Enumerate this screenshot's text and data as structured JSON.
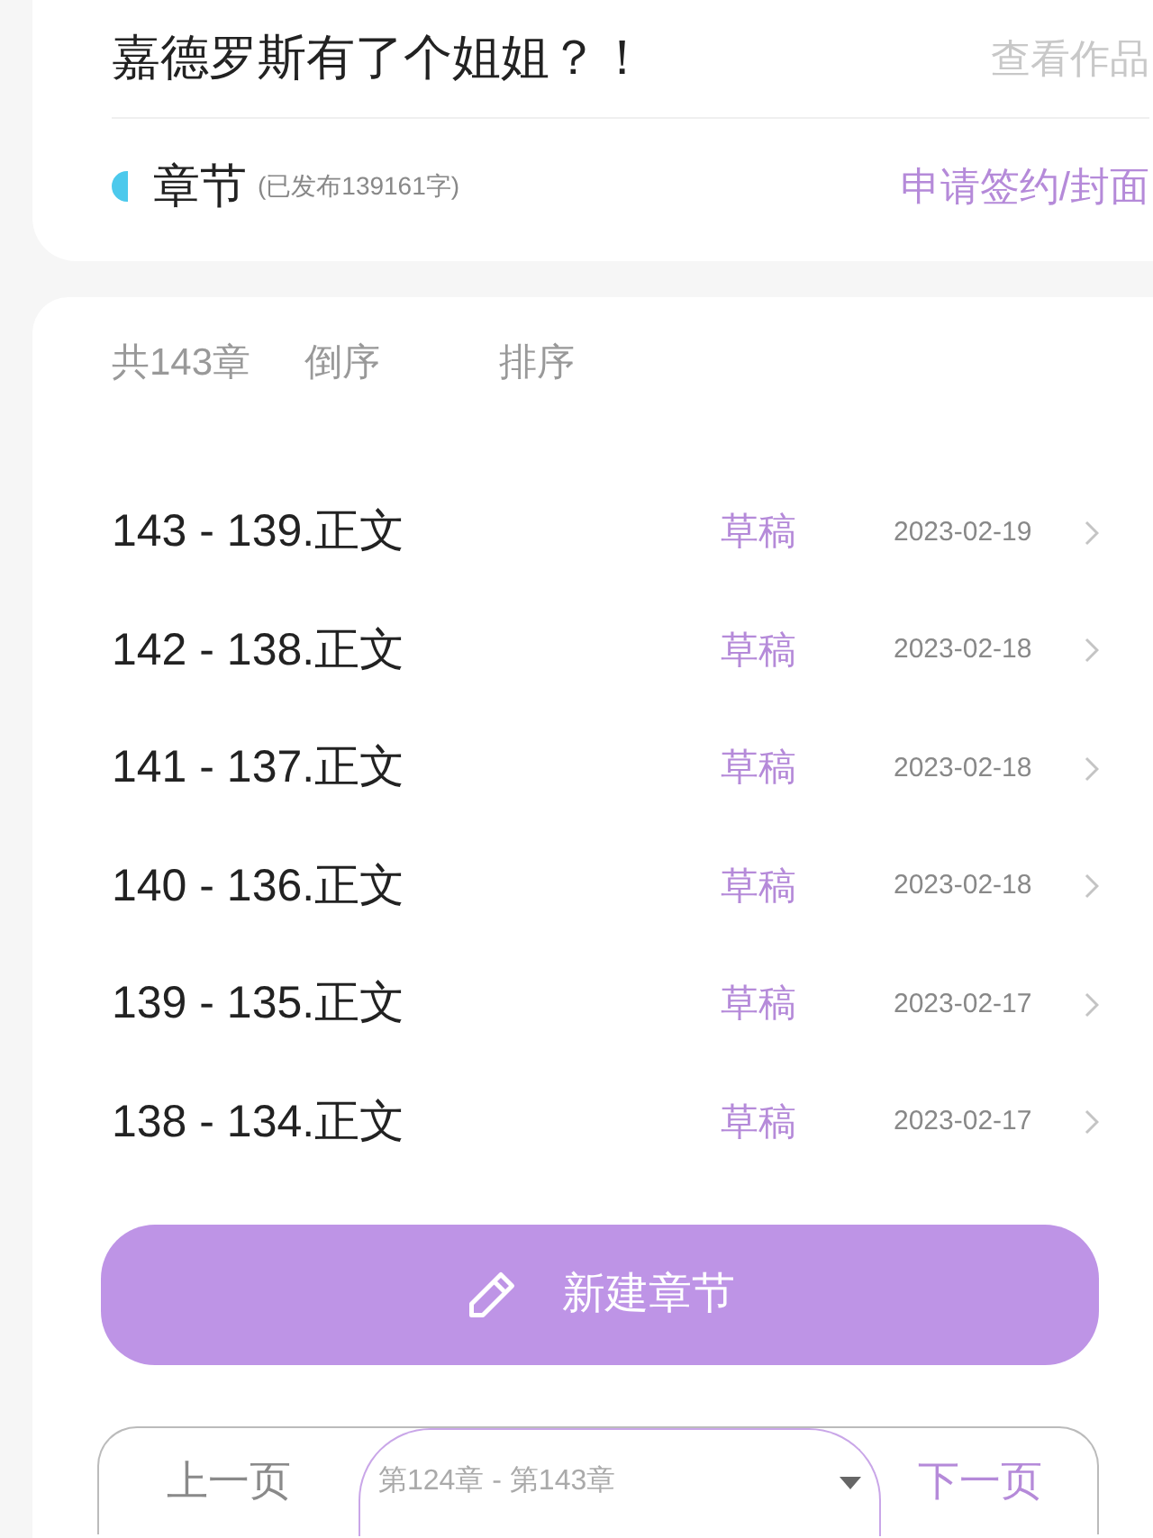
{
  "header": {
    "title": "嘉德罗斯有了个姐姐？！",
    "view_link": "查看作品"
  },
  "section": {
    "title": "章节",
    "word_count": "(已发布139161字)",
    "action": "申请签约/封面"
  },
  "toolbar": {
    "count": "共143章",
    "reverse": "倒序",
    "sort": "排序"
  },
  "chapters": [
    {
      "title": "143 - 139.正文",
      "status": "草稿",
      "date": "2023-02-19"
    },
    {
      "title": "142 - 138.正文",
      "status": "草稿",
      "date": "2023-02-18"
    },
    {
      "title": "141 - 137.正文",
      "status": "草稿",
      "date": "2023-02-18"
    },
    {
      "title": "140 - 136.正文",
      "status": "草稿",
      "date": "2023-02-18"
    },
    {
      "title": "139 - 135.正文",
      "status": "草稿",
      "date": "2023-02-17"
    },
    {
      "title": "138 - 134.正文",
      "status": "草稿",
      "date": "2023-02-17"
    }
  ],
  "new_button": {
    "label": "新建章节"
  },
  "pagination": {
    "prev": {
      "label": "上一页",
      "disabled": true
    },
    "range": "第124章 - 第143章",
    "next": {
      "label": "下一页",
      "disabled": false
    }
  }
}
